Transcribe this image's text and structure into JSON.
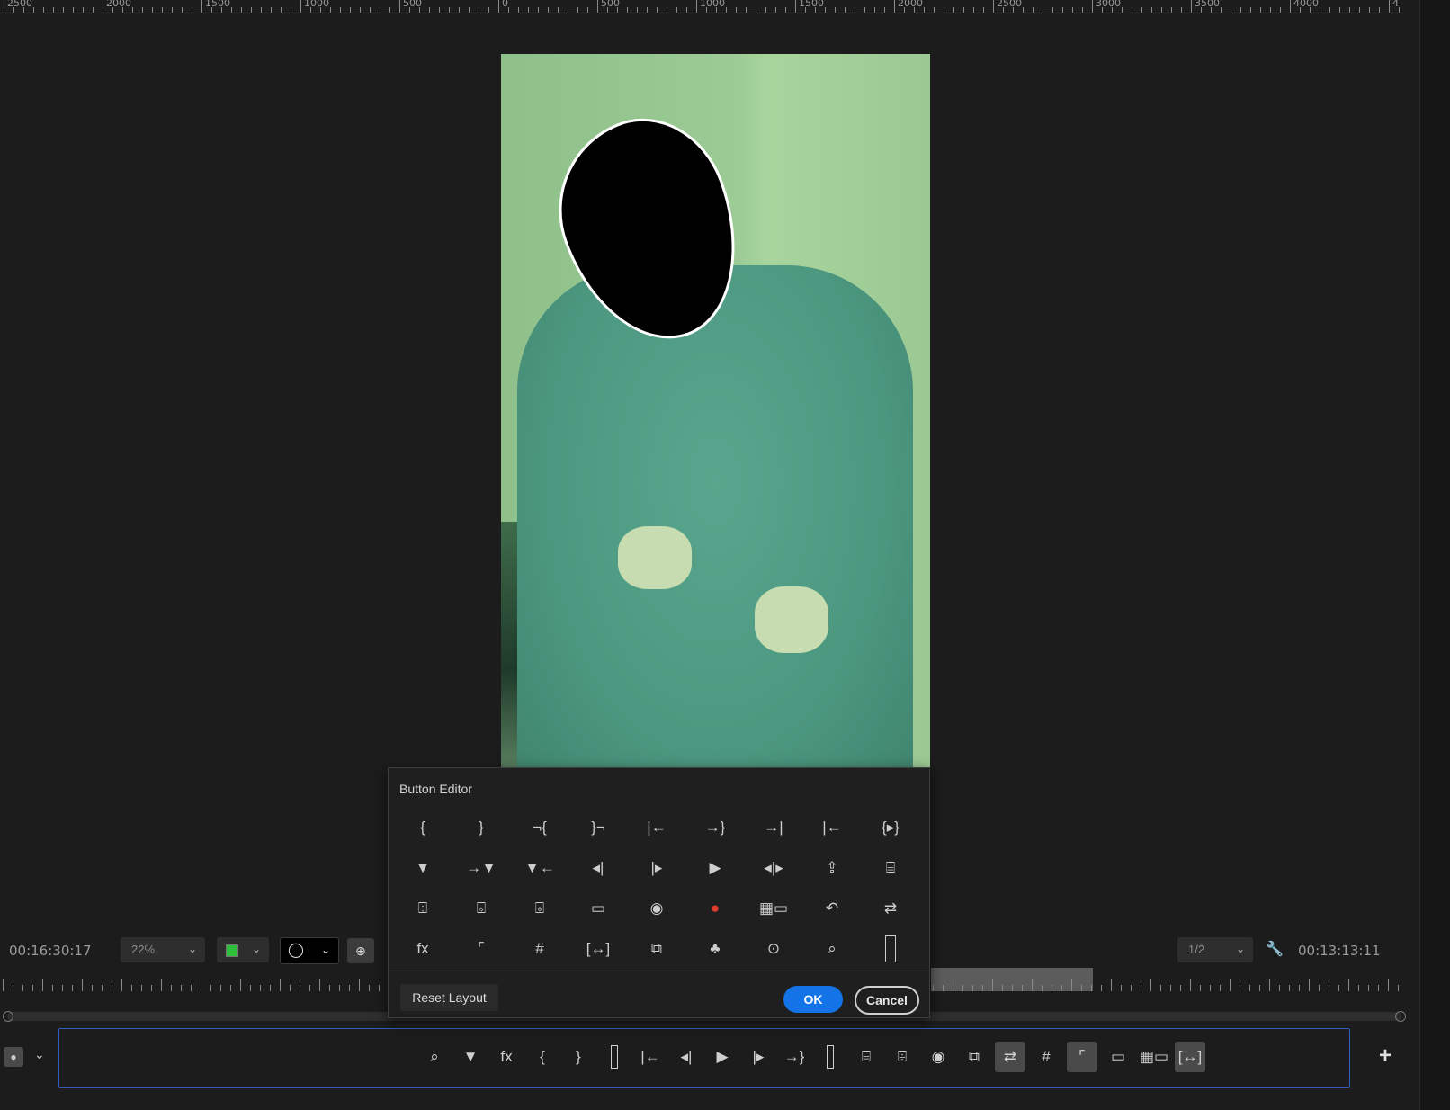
{
  "ruler": {
    "labels": [
      "2500",
      "2000",
      "1500",
      "1000",
      "500",
      "0",
      "500",
      "1000",
      "1500",
      "2000",
      "2500",
      "3000",
      "3500",
      "4000",
      "4"
    ]
  },
  "controls": {
    "timecode_left": "00:16:30:17",
    "zoom_value": "22%",
    "resolution_value": "1/2",
    "timecode_right": "00:13:13:11"
  },
  "dialog": {
    "title": "Button Editor",
    "reset_label": "Reset Layout",
    "ok_label": "OK",
    "cancel_label": "Cancel",
    "grid": [
      [
        "mark-in-icon",
        "mark-out-icon",
        "clear-in-icon",
        "clear-out-icon",
        "go-to-in-icon",
        "go-to-out-icon",
        "step-forward-edit-icon",
        "step-back-edit-icon",
        "play-in-to-out-icon"
      ],
      [
        "add-marker-icon",
        "go-to-next-marker-icon",
        "go-to-previous-marker-icon",
        "step-back-icon",
        "step-forward-icon",
        "play-icon",
        "trim-icon",
        "export-frame-icon",
        "lift-icon"
      ],
      [
        "extract-icon",
        "insert-icon",
        "overwrite-icon",
        "safe-margins-icon",
        "camera-icon",
        "record-icon",
        "multi-camera-icon",
        "loop-icon",
        "swap-icon"
      ],
      [
        "fx-icon",
        "show-rulers-icon",
        "show-guides-icon",
        "snap-icon",
        "comparison-view-icon",
        "audio-link-icon",
        "vr-video-icon",
        "proxy-icon",
        "spacer-icon"
      ]
    ]
  },
  "button_bar": {
    "buttons": [
      "proxy-icon",
      "add-marker-icon",
      "fx-icon",
      "mark-in-icon",
      "mark-out-icon",
      "spacer-icon",
      "go-to-in-icon",
      "step-back-icon",
      "play-icon",
      "step-forward-icon",
      "go-to-out-icon",
      "spacer-icon",
      "lift-icon",
      "extract-icon",
      "camera-icon",
      "comparison-view-icon",
      "swap-icon",
      "show-guides-icon",
      "show-rulers-icon",
      "safe-margins-icon",
      "multi-camera-icon",
      "snap-icon"
    ],
    "selected": [
      "swap-icon",
      "show-rulers-icon",
      "snap-icon"
    ],
    "add_label": "+"
  },
  "colors": {
    "accent": "#1473e6",
    "record": "#e03a2f",
    "bar_border": "#2e5fbf"
  }
}
